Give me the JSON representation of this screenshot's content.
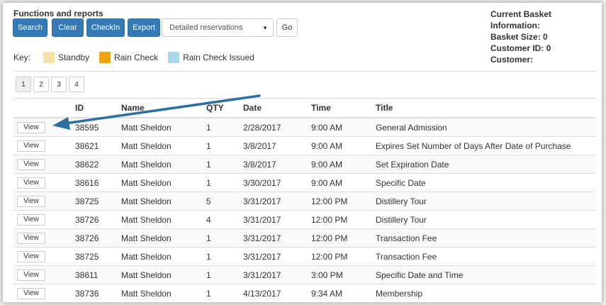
{
  "heading": "Functions and reports",
  "toolbar": {
    "search_label": "Search",
    "clear_label": "Clear",
    "checkin_label": "CheckIn",
    "export_label": "Export",
    "report_select": "Detailed reservations",
    "go_label": "Go"
  },
  "basket": {
    "title": "Current Basket Information:",
    "size": "Basket Size: 0",
    "customer_id": "Customer ID: 0",
    "customer": "Customer:"
  },
  "key": {
    "label": "Key:",
    "items": [
      {
        "label": "Standby",
        "color": "#f5e3a3"
      },
      {
        "label": "Rain Check",
        "color": "#f0a30a"
      },
      {
        "label": "Rain Check Issued",
        "color": "#a8d8ea"
      }
    ]
  },
  "pagination": [
    "1",
    "2",
    "3",
    "4"
  ],
  "table": {
    "headers": [
      "ID",
      "Name",
      "QTY",
      "Date",
      "Time",
      "Title"
    ],
    "view_label": "View",
    "rows": [
      {
        "id": "38595",
        "name": "Matt Sheldon",
        "qty": "1",
        "date": "2/28/2017",
        "time": "9:00 AM",
        "title": "General Admission"
      },
      {
        "id": "38621",
        "name": "Matt Sheldon",
        "qty": "1",
        "date": "3/8/2017",
        "time": "9:00 AM",
        "title": "Expires Set Number of Days After Date of Purchase"
      },
      {
        "id": "38622",
        "name": "Matt Sheldon",
        "qty": "1",
        "date": "3/8/2017",
        "time": "9:00 AM",
        "title": "Set Expiration Date"
      },
      {
        "id": "38616",
        "name": "Matt Sheldon",
        "qty": "1",
        "date": "3/30/2017",
        "time": "9:00 AM",
        "title": "Specific Date"
      },
      {
        "id": "38725",
        "name": "Matt Sheldon",
        "qty": "5",
        "date": "3/31/2017",
        "time": "12:00 PM",
        "title": "Distillery Tour"
      },
      {
        "id": "38726",
        "name": "Matt Sheldon",
        "qty": "4",
        "date": "3/31/2017",
        "time": "12:00 PM",
        "title": "Distillery Tour"
      },
      {
        "id": "38726",
        "name": "Matt Sheldon",
        "qty": "1",
        "date": "3/31/2017",
        "time": "12:00 PM",
        "title": "Transaction Fee"
      },
      {
        "id": "38725",
        "name": "Matt Sheldon",
        "qty": "1",
        "date": "3/31/2017",
        "time": "12:00 PM",
        "title": "Transaction Fee"
      },
      {
        "id": "38611",
        "name": "Matt Sheldon",
        "qty": "1",
        "date": "3/31/2017",
        "time": "3:00 PM",
        "title": "Specific Date and Time"
      },
      {
        "id": "38736",
        "name": "Matt Sheldon",
        "qty": "1",
        "date": "4/13/2017",
        "time": "9:34 AM",
        "title": "Membership"
      }
    ]
  },
  "colors": {
    "primary": "#337ab7",
    "arrow": "#2f6f9f"
  },
  "annotation": {
    "icon": "pointer-arrow-icon"
  }
}
